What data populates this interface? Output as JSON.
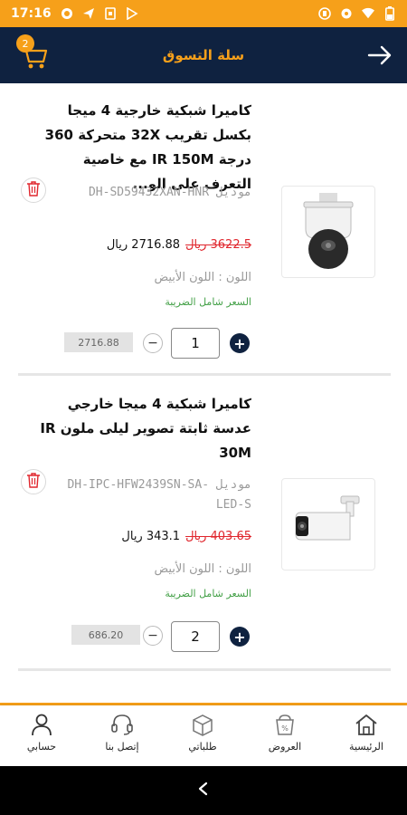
{
  "status_bar": {
    "time": "17:16",
    "icons_left": [
      "notification-icon",
      "navigation-icon",
      "sim-icon",
      "play-store-icon"
    ],
    "icons_right": [
      "vpn-icon",
      "settings-icon",
      "wifi-icon",
      "battery-icon"
    ]
  },
  "header": {
    "title": "سلة التسوق",
    "cart_count": "2"
  },
  "items": [
    {
      "title": "كاميرا شبكية خارجية 4 ميجا بكسل تقريب 32X متحركة 360 درجة IR 150M مع خاصية التعرف على الو...",
      "model": "موديل DH-SD59432XAN-HNR",
      "old_price": "3622.5 ريال",
      "new_price": "2716.88 ريال",
      "color": "اللون : اللون الأبيض",
      "tax_note": "السعر شامل الضريبة",
      "line_total": "2716.88",
      "quantity": "1",
      "image": "ptz-dome-camera"
    },
    {
      "title": "كاميرا شبكية 4 ميجا خارجي عدسة ثابتة تصوير ليلى ملون IR 30M",
      "model": "موديل DH-IPC-HFW2439SN-SA-LED-S",
      "old_price": "403.65 ريال",
      "new_price": "343.1 ريال",
      "color": "اللون : اللون الأبيض",
      "tax_note": "السعر شامل الضريبة",
      "line_total": "686.20",
      "quantity": "2",
      "image": "bullet-camera"
    }
  ],
  "bottom_nav": [
    {
      "label": "الرئيسية",
      "icon": "home-icon"
    },
    {
      "label": "العروض",
      "icon": "offers-icon"
    },
    {
      "label": "طلباتي",
      "icon": "orders-icon"
    },
    {
      "label": "إتصل بنا",
      "icon": "support-icon"
    },
    {
      "label": "حسابي",
      "icon": "account-icon"
    }
  ],
  "colors": {
    "accent": "#f6a01a",
    "header_bg": "#0f2240",
    "old_price": "#e0262d",
    "tax_note": "#43a047"
  }
}
